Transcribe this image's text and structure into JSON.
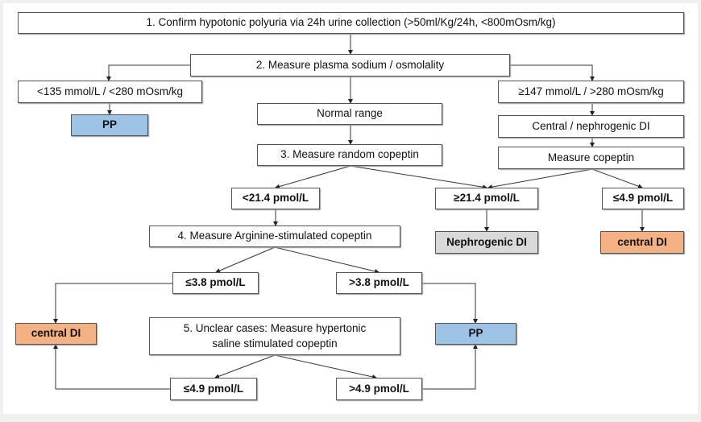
{
  "colors": {
    "pp": "#9dc3e6",
    "central_di": "#f4b183",
    "nephrogenic_di": "#d9d9d9"
  },
  "nodes": {
    "step1": "1.   Confirm hypotonic polyuria via 24h urine collection (>50ml/Kg/24h, <800mOsm/kg)",
    "step2": "2. Measure plasma sodium / osmolality",
    "low_sodium": "<135 mmol/L / <280 mOsm/kg",
    "pp_top": "PP",
    "normal_range": "Normal range",
    "step3": "3. Measure random copeptin",
    "high_sodium": "≥147 mmol/L / >280 mOsm/kg",
    "central_nephro": "Central / nephrogenic DI",
    "measure_copeptin": "Measure copeptin",
    "lt_21_4": "<21.4 pmol/L",
    "ge_21_4": "≥21.4 pmol/L",
    "le_4_9_right": "≤4.9 pmol/L",
    "step4": "4. Measure Arginine-stimulated copeptin",
    "nephrogenic_di": "Nephrogenic DI",
    "central_di_right": "central DI",
    "le_3_8": "≤3.8 pmol/L",
    "gt_3_8": ">3.8 pmol/L",
    "central_di_left": "central DI",
    "step5": "5. Unclear cases: Measure hypertonic saline stimulated copeptin",
    "pp_bottom": "PP",
    "le_4_9": "≤4.9 pmol/L",
    "gt_4_9": ">4.9 pmol/L"
  }
}
